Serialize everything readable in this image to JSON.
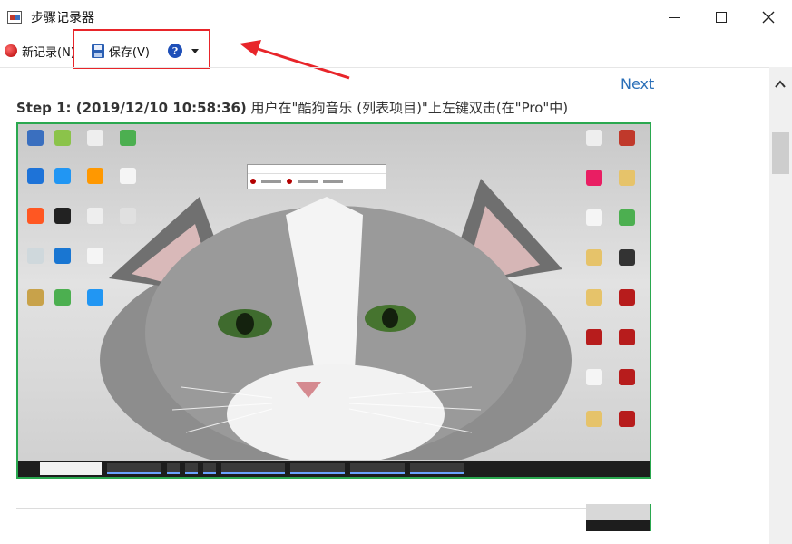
{
  "window": {
    "title": "步骤记录器"
  },
  "toolbar": {
    "new_record_label": "新记录(N)",
    "save_label": "保存(V)",
    "help_glyph": "?"
  },
  "content": {
    "next_link": "Next",
    "step_prefix": "Step 1: (2019/12/10 10:58:36)",
    "step_text": " 用户在\"酷狗音乐 (列表项目)\"上左键双击(在\"Pro\"中)"
  },
  "colors": {
    "highlight_box": "#e8252a",
    "arrow": "#e8252a",
    "screenshot_border": "#2aa84f",
    "link": "#2a6fb8"
  },
  "icons": [
    "app-icon",
    "record-dot-icon",
    "floppy-save-icon",
    "help-icon",
    "dropdown-caret-icon",
    "minimize-icon",
    "maximize-icon",
    "close-icon",
    "scroll-up-icon"
  ]
}
